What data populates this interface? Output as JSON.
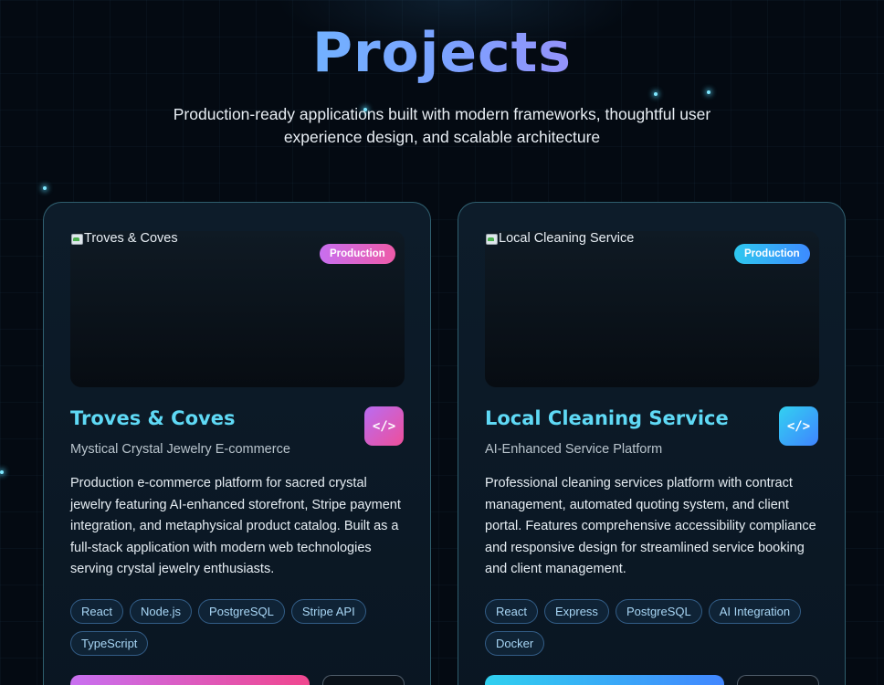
{
  "section": {
    "title": "Projects",
    "subtitle": "Production-ready applications built with modern frameworks, thoughtful user experience design, and scalable architecture"
  },
  "projects": [
    {
      "image_alt": "Troves & Coves",
      "badge": "Production",
      "title": "Troves & Coves",
      "code_icon": "</>",
      "subtitle": "Mystical Crystal Jewelry E-commerce",
      "description": "Production e-commerce platform for sacred crystal jewelry featuring AI-enhanced storefront, Stripe payment integration, and metaphysical product catalog. Built as a full-stack application with modern web technologies serving crystal jewelry enthusiasts.",
      "tags": [
        "React",
        "Node.js",
        "PostgreSQL",
        "Stripe API",
        "TypeScript"
      ],
      "accent": "#c870f0"
    },
    {
      "image_alt": "Local Cleaning Service",
      "badge": "Production",
      "title": "Local Cleaning Service",
      "code_icon": "</>",
      "subtitle": "AI-Enhanced Service Platform",
      "description": "Professional cleaning services platform with contract management, automated quoting system, and client portal. Features comprehensive accessibility compliance and responsive design for streamlined service booking and client management.",
      "tags": [
        "React",
        "Express",
        "PostgreSQL",
        "AI Integration",
        "Docker"
      ],
      "accent": "#30d0ef"
    }
  ]
}
